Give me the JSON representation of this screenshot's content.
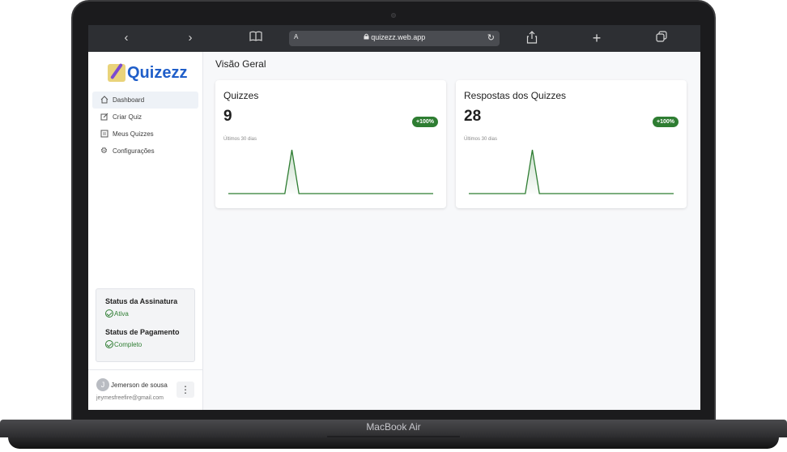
{
  "device": {
    "model_label": "MacBook Air"
  },
  "browser": {
    "url": "quizezz.web.app",
    "reader_label": "A",
    "icons": [
      "chevron-left-icon",
      "chevron-right-icon",
      "book-icon",
      "lock-icon",
      "reload-icon",
      "share-icon",
      "plus-icon",
      "tabs-icon"
    ]
  },
  "sidebar": {
    "logo_text": "Quizezz",
    "items": [
      {
        "label": "Dashboard",
        "icon": "home-icon",
        "active": true
      },
      {
        "label": "Criar Quiz",
        "icon": "edit-icon",
        "active": false
      },
      {
        "label": "Meus Quizzes",
        "icon": "list-icon",
        "active": false
      },
      {
        "label": "Configurações",
        "icon": "gear-icon",
        "active": false
      }
    ],
    "status": {
      "subscription_title": "Status da Assinatura",
      "subscription_value": "Ativa",
      "payment_title": "Status de Pagamento",
      "payment_value": "Completo"
    },
    "user": {
      "initial": "J",
      "name": "Jemerson de sousa",
      "email": "jeymesfreefire@gmail.com"
    }
  },
  "main": {
    "title": "Visão Geral",
    "cards": [
      {
        "title": "Quizzes",
        "value": "9",
        "badge": "+100%",
        "subtitle": "Últimos 30 dias"
      },
      {
        "title": "Respostas dos Quizzes",
        "value": "28",
        "badge": "+100%",
        "subtitle": "Últimos 30 dias"
      }
    ]
  },
  "colors": {
    "accent_green": "#2e7d32",
    "brand_blue": "#1f5ec9",
    "browser_bar": "#2d2f33"
  },
  "chart_data": [
    {
      "type": "area",
      "series": [
        {
          "values": [
            0,
            0,
            0,
            0,
            0,
            0,
            0,
            0,
            0,
            9,
            0,
            0,
            0,
            0,
            0,
            0,
            0,
            0,
            0,
            0,
            0,
            0,
            0,
            0,
            0,
            0,
            0,
            0,
            0,
            0
          ]
        }
      ]
    },
    {
      "type": "area",
      "series": [
        {
          "values": [
            0,
            0,
            0,
            0,
            0,
            0,
            0,
            0,
            0,
            28,
            0,
            0,
            0,
            0,
            0,
            0,
            0,
            0,
            0,
            0,
            0,
            0,
            0,
            0,
            0,
            0,
            0,
            0,
            0,
            0
          ]
        }
      ]
    }
  ]
}
